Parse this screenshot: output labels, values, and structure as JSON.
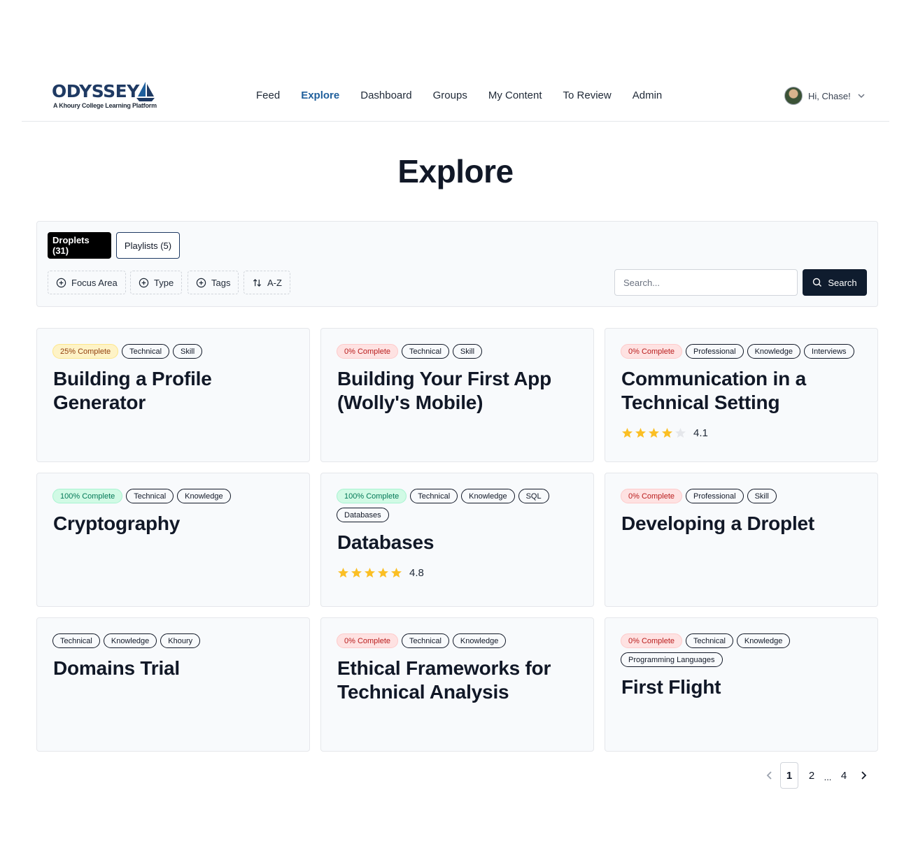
{
  "brand": {
    "name": "ODYSSEY",
    "tagline": "A Khoury College Learning Platform",
    "color": "#1f3a63"
  },
  "nav": {
    "items": [
      {
        "label": "Feed",
        "active": false
      },
      {
        "label": "Explore",
        "active": true
      },
      {
        "label": "Dashboard",
        "active": false
      },
      {
        "label": "Groups",
        "active": false
      },
      {
        "label": "My Content",
        "active": false
      },
      {
        "label": "To Review",
        "active": false
      },
      {
        "label": "Admin",
        "active": false
      }
    ],
    "accent": "#1f5f9c"
  },
  "user": {
    "greeting": "Hi, Chase!"
  },
  "page": {
    "title": "Explore"
  },
  "tabs": {
    "droplets": "Droplets (31)",
    "playlists": "Playlists (5)"
  },
  "filters": {
    "focus_area": "Focus Area",
    "type": "Type",
    "tags": "Tags",
    "sort": "A-Z"
  },
  "search": {
    "placeholder": "Search...",
    "button": "Search"
  },
  "cards": [
    {
      "progress": "25% Complete",
      "progress_color": "yellow",
      "tags": [
        "Technical",
        "Skill"
      ],
      "title": "Building a Profile Generator",
      "rating": null
    },
    {
      "progress": "0% Complete",
      "progress_color": "red",
      "tags": [
        "Technical",
        "Skill"
      ],
      "title": "Building Your First App (Wolly's Mobile)",
      "rating": null
    },
    {
      "progress": "0% Complete",
      "progress_color": "red",
      "tags": [
        "Professional",
        "Knowledge",
        "Interviews"
      ],
      "title": "Communication in a Technical Setting",
      "rating": "4.1",
      "stars": 4
    },
    {
      "progress": "100% Complete",
      "progress_color": "green",
      "tags": [
        "Technical",
        "Knowledge"
      ],
      "title": "Cryptography",
      "rating": null
    },
    {
      "progress": "100% Complete",
      "progress_color": "green",
      "tags": [
        "Technical",
        "Knowledge",
        "SQL",
        "Databases"
      ],
      "title": "Databases",
      "rating": "4.8",
      "stars": 5
    },
    {
      "progress": "0% Complete",
      "progress_color": "red",
      "tags": [
        "Professional",
        "Skill"
      ],
      "title": "Developing a Droplet",
      "rating": null
    },
    {
      "progress": null,
      "progress_color": null,
      "tags": [
        "Technical",
        "Knowledge",
        "Khoury"
      ],
      "title": "Domains Trial",
      "rating": null
    },
    {
      "progress": "0% Complete",
      "progress_color": "red",
      "tags": [
        "Technical",
        "Knowledge"
      ],
      "title": "Ethical Frameworks for Technical Analysis",
      "rating": null
    },
    {
      "progress": "0% Complete",
      "progress_color": "red",
      "tags": [
        "Technical",
        "Knowledge",
        "Programming Languages"
      ],
      "title": "First Flight",
      "rating": null
    }
  ],
  "pagination": {
    "pages": [
      "1",
      "2",
      "4"
    ],
    "ellipsis": "...",
    "current": "1"
  },
  "colors": {
    "star": "#fbbf24",
    "star_empty": "#e5e7eb",
    "search_button": "#0f1c2e"
  }
}
